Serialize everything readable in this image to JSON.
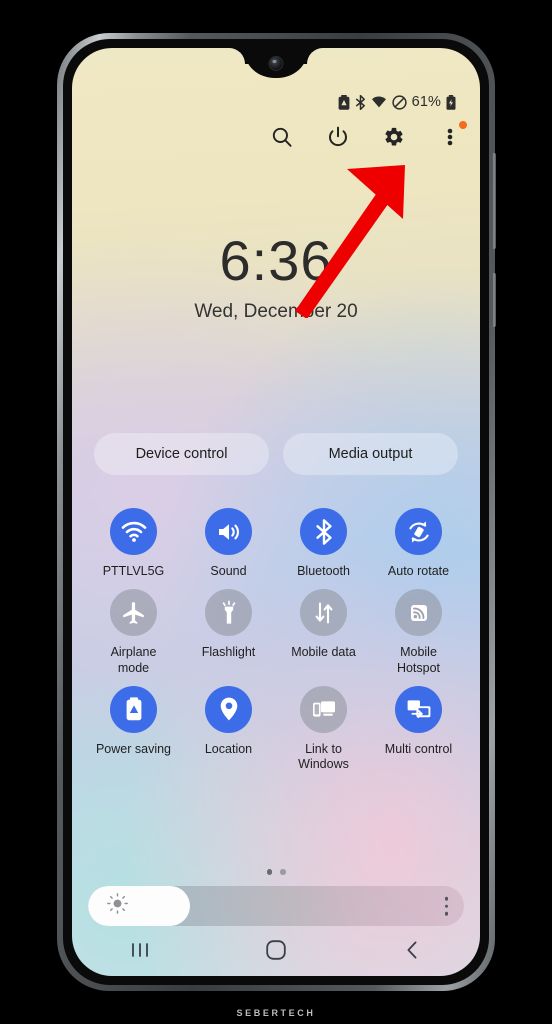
{
  "device": {
    "brand_watermark": "SEBERTECH",
    "side_buttons": [
      "volume-rocker",
      "power-button"
    ]
  },
  "status_bar": {
    "icons": [
      "battery-saver-icon",
      "bluetooth-icon",
      "wifi-icon",
      "do-not-disturb-icon"
    ],
    "battery_percent": "61%",
    "battery_icon": "battery-charging-icon"
  },
  "quick_actions": {
    "items": [
      {
        "name": "search-icon",
        "label": "Search"
      },
      {
        "name": "power-icon",
        "label": "Power"
      },
      {
        "name": "settings-gear-icon",
        "label": "Settings"
      },
      {
        "name": "overflow-menu-icon",
        "label": "More options",
        "badge": true
      }
    ],
    "badge_color": "#f36d1c"
  },
  "clock": {
    "time": "6:36",
    "date": "Wed, December 20"
  },
  "annotation": {
    "type": "arrow",
    "color": "#ee0000",
    "points_to": "power-icon"
  },
  "pills": [
    {
      "label": "Device control"
    },
    {
      "label": "Media output"
    }
  ],
  "toggles": {
    "active_color": "#3d6ce8",
    "inactive_color": "rgba(140,145,155,0.55)",
    "rows": [
      [
        {
          "label": "PTTLVL5G",
          "icon": "wifi-icon",
          "active": true
        },
        {
          "label": "Sound",
          "icon": "volume-icon",
          "active": true
        },
        {
          "label": "Bluetooth",
          "icon": "bluetooth-icon",
          "active": true
        },
        {
          "label": "Auto rotate",
          "icon": "auto-rotate-icon",
          "active": true
        }
      ],
      [
        {
          "label": "Airplane mode",
          "icon": "airplane-icon",
          "active": false
        },
        {
          "label": "Flashlight",
          "icon": "flashlight-icon",
          "active": false
        },
        {
          "label": "Mobile data",
          "icon": "mobile-data-icon",
          "active": false
        },
        {
          "label": "Mobile Hotspot",
          "icon": "hotspot-icon",
          "active": false
        }
      ],
      [
        {
          "label": "Power saving",
          "icon": "power-saving-icon",
          "active": true
        },
        {
          "label": "Location",
          "icon": "location-pin-icon",
          "active": true
        },
        {
          "label": "Link to Windows",
          "icon": "link-to-windows-icon",
          "active": false
        },
        {
          "label": "Multi control",
          "icon": "multi-control-icon",
          "active": true
        }
      ]
    ]
  },
  "page_indicator": {
    "total": 2,
    "active": 1
  },
  "brightness": {
    "level_percent": 27,
    "icon": "brightness-sun-icon",
    "menu_icon": "overflow-menu-icon"
  },
  "nav_bar": {
    "buttons": [
      {
        "name": "recents-button",
        "icon": "recents-icon"
      },
      {
        "name": "home-button",
        "icon": "home-icon"
      },
      {
        "name": "back-button",
        "icon": "back-chevron-icon"
      }
    ]
  }
}
